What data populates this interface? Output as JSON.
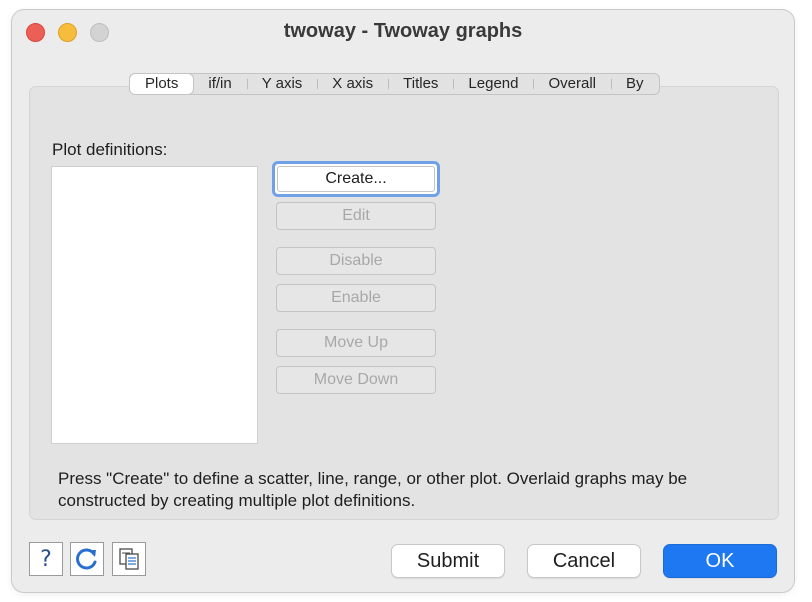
{
  "window": {
    "title": "twoway - Twoway graphs"
  },
  "tabs": [
    {
      "label": "Plots",
      "active": true
    },
    {
      "label": "if/in"
    },
    {
      "label": "Y axis"
    },
    {
      "label": "X axis"
    },
    {
      "label": "Titles"
    },
    {
      "label": "Legend"
    },
    {
      "label": "Overall"
    },
    {
      "label": "By"
    }
  ],
  "plots": {
    "label": "Plot definitions:",
    "buttons": {
      "create": "Create...",
      "edit": "Edit",
      "disable": "Disable",
      "enable": "Enable",
      "move_up": "Move Up",
      "move_down": "Move Down"
    },
    "help_text": "Press \"Create\" to define a scatter, line, range, or other plot. Overlaid graphs may be constructed by creating multiple plot definitions."
  },
  "footer": {
    "help_icon": "help-icon",
    "reset_icon": "reset-icon",
    "copy_icon": "copy-command-icon",
    "submit": "Submit",
    "cancel": "Cancel",
    "ok": "OK"
  },
  "colors": {
    "ok_button": "#1d78f2",
    "focus_ring": "#6fa0e8",
    "close": "#ec5f57",
    "minimize": "#f5bd3b"
  }
}
